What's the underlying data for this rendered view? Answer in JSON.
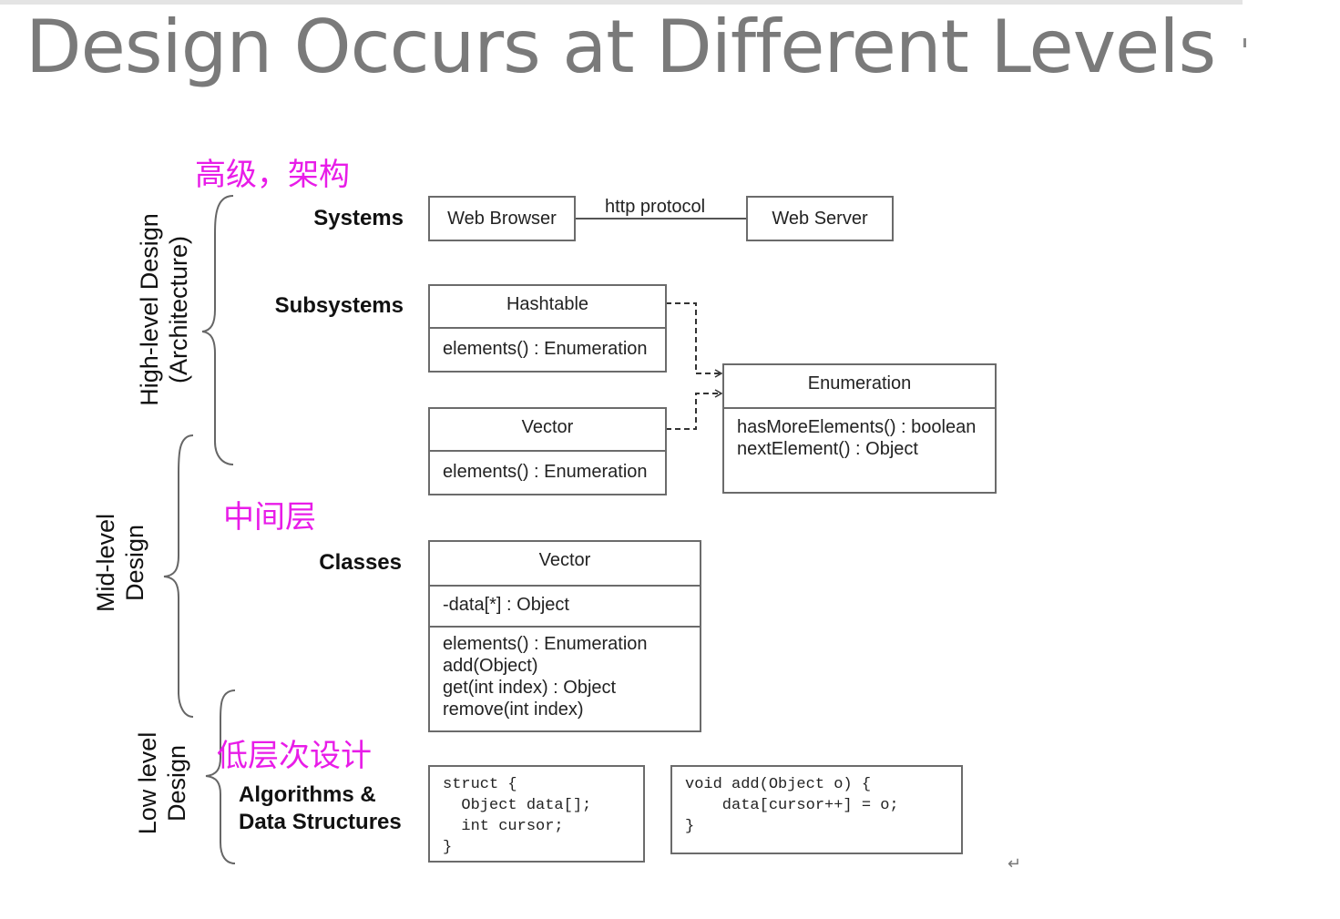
{
  "title": "Design Occurs at Different Levels",
  "annotations": {
    "high": "高级，架构",
    "mid": "中间层",
    "low": "低层次设计"
  },
  "groups": {
    "high_line1": "High-level Design",
    "high_line2": "(Architecture)",
    "mid_line1": "Mid-level",
    "mid_line2": "Design",
    "low_line1": "Low level",
    "low_line2": "Design"
  },
  "levels": {
    "systems": "Systems",
    "subsystems": "Subsystems",
    "classes": "Classes",
    "algorithms_line1": "Algorithms &",
    "algorithms_line2": "Data Structures"
  },
  "systems": {
    "browser": "Web Browser",
    "server": "Web Server",
    "link": "http protocol"
  },
  "subsystems": {
    "hashtable": {
      "name": "Hashtable",
      "method": "elements() : Enumeration"
    },
    "vector": {
      "name": "Vector",
      "method": "elements() : Enumeration"
    },
    "enumeration": {
      "name": "Enumeration",
      "methods": [
        "hasMoreElements() : boolean",
        "nextElement() : Object"
      ]
    }
  },
  "classes": {
    "vector": {
      "name": "Vector",
      "attribute": "-data[*] : Object",
      "methods": [
        "elements() : Enumeration",
        "add(Object)",
        "get(int index) : Object",
        "remove(int index)"
      ]
    }
  },
  "algorithms": {
    "struct_code": [
      "struct {",
      "  Object data[];",
      "  int cursor;",
      "}"
    ],
    "func_code": [
      "void add(Object o) {",
      "    data[cursor++] = o;",
      "}"
    ]
  },
  "return_mark": "↵"
}
